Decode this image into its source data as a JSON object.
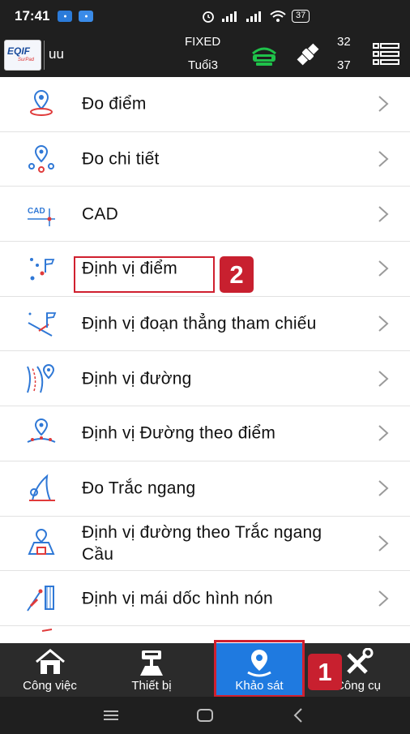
{
  "status_bar": {
    "time": "17:41",
    "battery": "37"
  },
  "header": {
    "project_name": "uu",
    "fix_status": "FIXED",
    "fix_age": "Tuổi3",
    "sat_used": "32",
    "sat_visible": "37"
  },
  "logo": {
    "text": "EQIF",
    "sub": "SurPad"
  },
  "list": {
    "items": [
      {
        "label": "Đo điểm",
        "icon": "point-pin-icon"
      },
      {
        "label": "Đo chi tiết",
        "icon": "detail-pins-icon"
      },
      {
        "label": "CAD",
        "icon": "cad-icon"
      },
      {
        "label": "Định vị điểm",
        "icon": "stakeout-point-icon"
      },
      {
        "label": "Định vị đoạn thẳng tham chiếu",
        "icon": "stakeout-line-icon"
      },
      {
        "label": "Định vị đường",
        "icon": "stakeout-road-icon"
      },
      {
        "label": "Định vị Đường theo điểm",
        "icon": "road-by-point-icon"
      },
      {
        "label": "Đo Trắc ngang",
        "icon": "cross-section-icon"
      },
      {
        "label": "Định vị đường theo Trắc ngang Cầu",
        "icon": "bridge-section-icon"
      },
      {
        "label": "Định vị mái dốc hình nón",
        "icon": "cone-slope-icon"
      }
    ]
  },
  "annotations": {
    "step1": "1",
    "step2": "2"
  },
  "tabbar": {
    "tabs": [
      {
        "label": "Công việc",
        "icon": "home-icon"
      },
      {
        "label": "Thiết bị",
        "icon": "receiver-icon"
      },
      {
        "label": "Khảo sát",
        "icon": "survey-pin-icon"
      },
      {
        "label": "Công cụ",
        "icon": "tools-icon"
      }
    ],
    "active_index": 2
  },
  "colors": {
    "accent": "#1f7ae0",
    "highlight": "#d0202f",
    "icon_blue": "#2f78d6",
    "icon_red": "#e03b3b"
  }
}
